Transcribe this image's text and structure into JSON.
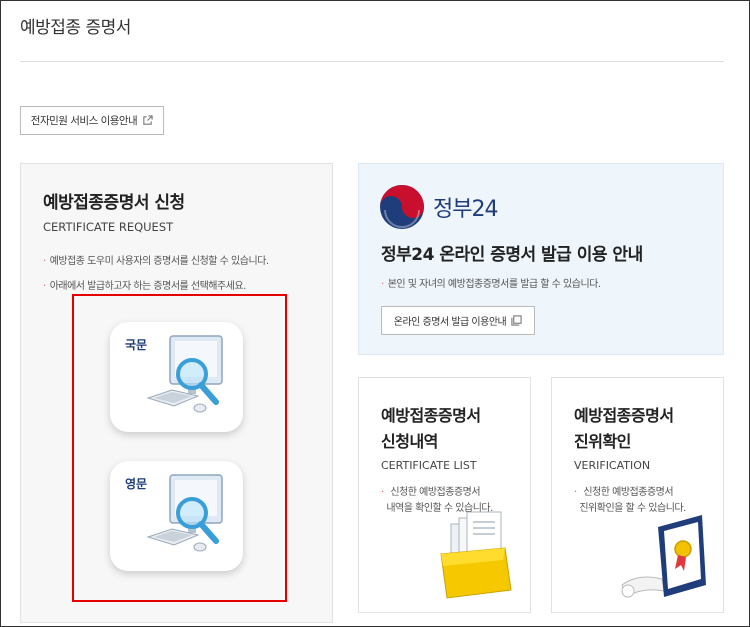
{
  "page": {
    "title": "예방접종 증명서"
  },
  "service_button": {
    "label": "전자민원 서비스 이용안내",
    "icon": "external-link-icon"
  },
  "request_card": {
    "title": "예방접종증명서 신청",
    "subtitle": "CERTIFICATE REQUEST",
    "bullets": [
      "예방접종 도우미 사용자의 증명서를 신청할 수 있습니다.",
      "아래에서 발급하고자 하는 증명서를 선택해주세요."
    ],
    "options": [
      {
        "label": "국문",
        "icon": "computer-search-icon"
      },
      {
        "label": "영문",
        "icon": "computer-search-icon"
      }
    ]
  },
  "gov24_card": {
    "logo_text": "정부24",
    "title": "정부24 온라인 증명서 발급 이용 안내",
    "bullet": "본인 및 자녀의 예방접종증명서를 발급 할 수 있습니다.",
    "button_label": "온라인 증명서 발급 이용안내",
    "button_icon": "copy-window-icon"
  },
  "list_card": {
    "title_line1": "예방접종증명서",
    "title_line2": "신청내역",
    "subtitle": "CERTIFICATE LIST",
    "bullet_line1": "신청한 예방접종증명서",
    "bullet_line2": "내역을 확인할 수 있습니다.",
    "icon": "document-box-icon"
  },
  "verify_card": {
    "title_line1": "예방접종증명서",
    "title_line2": "진위확인",
    "subtitle": "VERIFICATION",
    "bullet_line1": "신청한 예방접종증명서",
    "bullet_line2": "진위확인을 할 수 있습니다.",
    "icon": "certificate-icon"
  },
  "colors": {
    "highlight_border": "#e50000",
    "brand_navy": "#1f3d7a",
    "gov_red": "#c8102e"
  }
}
